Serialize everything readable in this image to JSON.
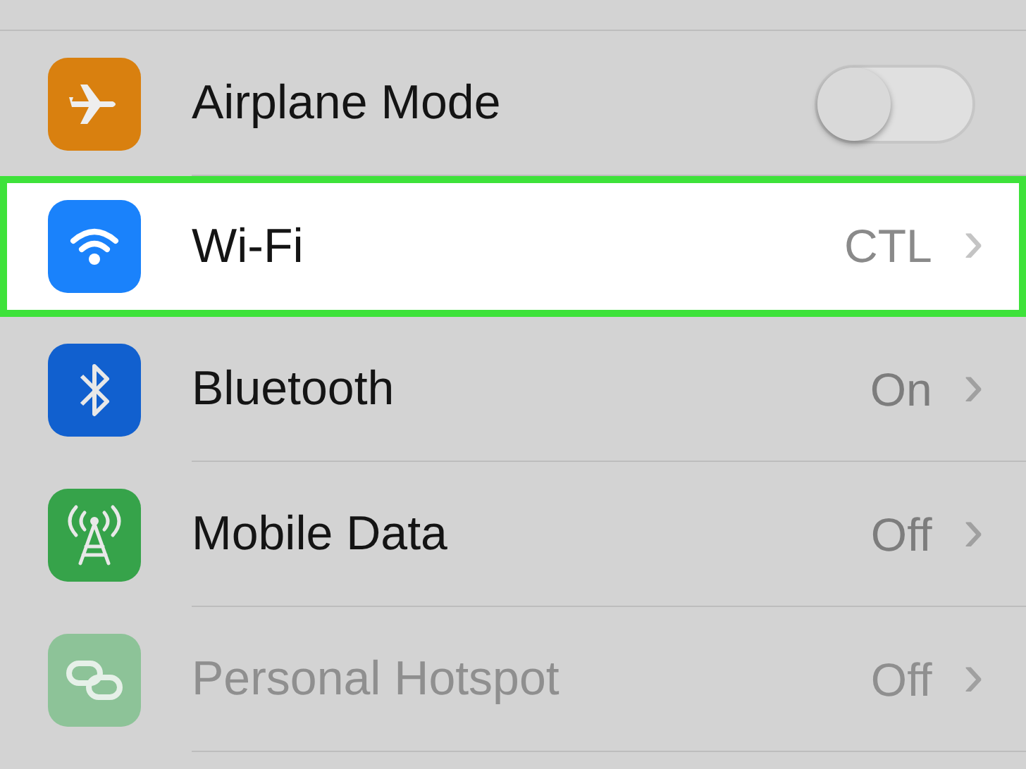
{
  "settings": [
    {
      "kind": "toggle",
      "label": "Airplane Mode",
      "on": false,
      "highlighted": false,
      "disabled": false
    },
    {
      "kind": "link",
      "label": "Wi-Fi",
      "value": "CTL",
      "chevron": "›",
      "highlighted": true,
      "disabled": false
    },
    {
      "kind": "link",
      "label": "Bluetooth",
      "value": "On",
      "chevron": "›",
      "highlighted": false,
      "disabled": false
    },
    {
      "kind": "link",
      "label": "Mobile Data",
      "value": "Off",
      "chevron": "›",
      "highlighted": false,
      "disabled": false
    },
    {
      "kind": "link",
      "label": "Personal Hotspot",
      "value": "Off",
      "chevron": "›",
      "highlighted": false,
      "disabled": true
    }
  ]
}
